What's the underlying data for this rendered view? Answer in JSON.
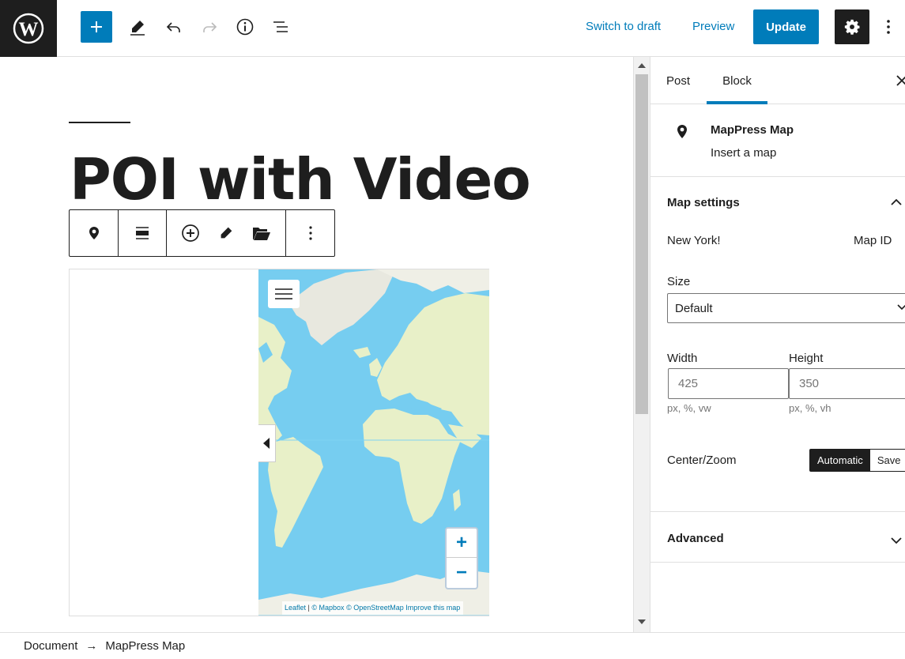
{
  "header": {
    "switch_to_draft": "Switch to draft",
    "preview": "Preview",
    "update": "Update"
  },
  "post": {
    "title": "POI with Video"
  },
  "map": {
    "attribution_leaflet": "Leaflet",
    "attribution_mapbox": "© Mapbox",
    "attribution_osm": "© OpenStreetMap",
    "attribution_improve": "Improve this map",
    "zoom_in": "+",
    "zoom_out": "−"
  },
  "sidebar": {
    "tabs": [
      {
        "label": "Post",
        "active": false
      },
      {
        "label": "Block",
        "active": true
      }
    ],
    "block_card": {
      "title": "MapPress Map",
      "description": "Insert a map"
    },
    "map_settings": {
      "heading": "Map settings",
      "map_name": "New York!",
      "map_id_label": "Map ID",
      "size_label": "Size",
      "size_value": "Default",
      "width_label": "Width",
      "width_value": "425",
      "width_hint": "px, %, vw",
      "height_label": "Height",
      "height_value": "350",
      "height_hint": "px, %, vh",
      "center_zoom_label": "Center/Zoom",
      "center_zoom_options": [
        "Automatic",
        "Save"
      ],
      "center_zoom_selected": "Automatic"
    },
    "advanced": {
      "heading": "Advanced"
    }
  },
  "breadcrumb": {
    "items": [
      "Document",
      "MapPress Map"
    ],
    "separator": "→"
  },
  "colors": {
    "accent": "#007cba",
    "dark": "#1e1e1e",
    "ocean": "#76cdf0",
    "land": "#e8f0c8"
  }
}
